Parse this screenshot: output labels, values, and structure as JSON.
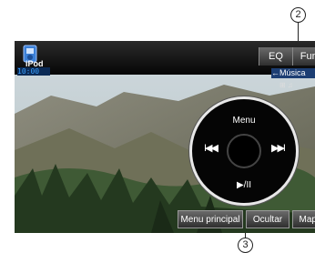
{
  "callouts": {
    "top": "2",
    "bottom": "3"
  },
  "source": {
    "label": "iPod",
    "time": "10:00",
    "icon": "ipod-source-icon"
  },
  "tabs": {
    "eq": "EQ",
    "func": "Func"
  },
  "music_label": "←Música",
  "status_icons": "⊞ ♫",
  "disk": {
    "menu": "Menu",
    "prev": "I◀◀",
    "next": "▶▶I",
    "play": "▶/II"
  },
  "buttons": {
    "main": "Menu principal",
    "hide": "Ocultar",
    "map": "Mapa"
  }
}
